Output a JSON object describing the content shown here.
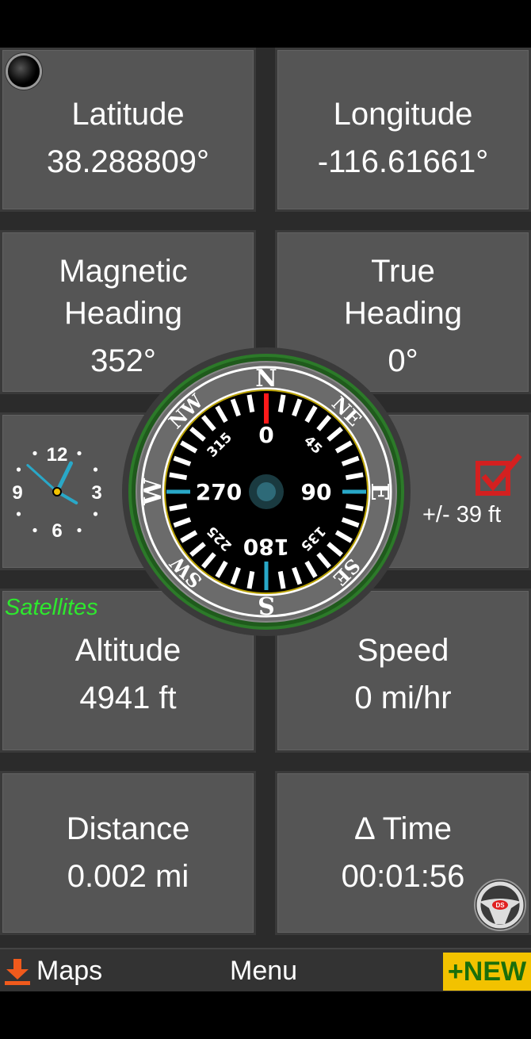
{
  "gps": {
    "latitude": {
      "label": "Latitude",
      "value": "38.288809°"
    },
    "longitude": {
      "label": "Longitude",
      "value": "-116.61661°"
    },
    "magnetic_heading": {
      "label_line1": "Magnetic",
      "label_line2": "Heading",
      "value": "352°"
    },
    "true_heading": {
      "label_line1": "True",
      "label_line2": "Heading",
      "value": "0°"
    },
    "altitude": {
      "label": "Altitude",
      "value": "4941 ft"
    },
    "speed": {
      "label": "Speed",
      "value": "0 mi/hr"
    },
    "distance": {
      "label": "Distance",
      "value": "0.002 mi"
    },
    "delta_time": {
      "label": "Δ Time",
      "value": "00:01:56"
    }
  },
  "satellites_label": "Satellites",
  "accuracy": "+/- 39 ft",
  "accuracy_checked": true,
  "clock": {
    "numerals": [
      "12",
      "3",
      "6",
      "9"
    ],
    "hour": 12,
    "minute": 52
  },
  "compass": {
    "cardinals": [
      "N",
      "E",
      "S",
      "W"
    ],
    "intercardinals": [
      "NE",
      "SE",
      "SW",
      "NW"
    ],
    "dial_numbers": [
      "0",
      "90",
      "180",
      "270"
    ],
    "minor_numbers": [
      "45",
      "135",
      "225",
      "315"
    ]
  },
  "bottom_bar": {
    "maps_label": "Maps",
    "menu_label": "Menu",
    "new_label": "+NEW"
  },
  "badge_text": "DS",
  "colors": {
    "panel": "#555555",
    "satellites": "#2ee82e",
    "check": "#d42020",
    "new_bg": "#f2c200",
    "new_text": "#1a6e0b",
    "compass_north": "#ff1a1a",
    "compass_cardinal": "#29a8c8",
    "compass_intercardinal": "#f2e500",
    "download_icon": "#f05a1c"
  }
}
